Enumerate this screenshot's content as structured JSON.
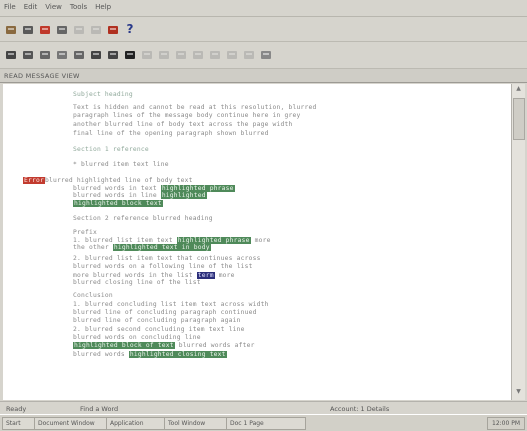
{
  "menu": [
    {
      "label": "File",
      "name": "menu-file"
    },
    {
      "label": "Edit",
      "name": "menu-edit"
    },
    {
      "label": "View",
      "name": "menu-view"
    },
    {
      "label": "Tools",
      "name": "menu-tools"
    },
    {
      "label": "Help",
      "name": "menu-help"
    }
  ],
  "toolbar1": [
    {
      "icon": "print-icon",
      "color": "#8a6a40"
    },
    {
      "icon": "cut-icon",
      "color": "#5a5a5a"
    },
    {
      "icon": "car-icon",
      "color": "#c0392b"
    },
    {
      "icon": "cart-icon",
      "color": "#666"
    },
    {
      "icon": "gear-icon",
      "color": "#999",
      "dim": true
    },
    {
      "icon": "pencil-icon",
      "color": "#999",
      "dim": true
    },
    {
      "icon": "flag-icon",
      "color": "#b03020"
    },
    {
      "icon": "help-icon",
      "color": "#2a3a8a",
      "glyph": "?"
    }
  ],
  "toolbar2": [
    {
      "icon": "pointer-icon",
      "color": "#444"
    },
    {
      "icon": "check-icon",
      "color": "#555"
    },
    {
      "icon": "grid-icon",
      "color": "#666"
    },
    {
      "icon": "list-icon",
      "color": "#777"
    },
    {
      "icon": "page-icon",
      "color": "#666"
    },
    {
      "icon": "table-icon",
      "color": "#444"
    },
    {
      "icon": "columns-icon",
      "color": "#444"
    },
    {
      "icon": "block-icon",
      "color": "#222"
    },
    {
      "icon": "arrow-icon",
      "color": "#999",
      "dim": true
    },
    {
      "icon": "brush-icon",
      "color": "#999",
      "dim": true
    },
    {
      "icon": "pen-icon",
      "color": "#999",
      "dim": true
    },
    {
      "icon": "line-icon",
      "color": "#999",
      "dim": true
    },
    {
      "icon": "frame-icon",
      "color": "#999",
      "dim": true
    },
    {
      "icon": "image-icon",
      "color": "#999",
      "dim": true
    },
    {
      "icon": "stack-icon",
      "color": "#999",
      "dim": true
    },
    {
      "icon": "doc-icon",
      "color": "#888"
    }
  ],
  "address": "READ MESSAGE VIEW",
  "doc_lines": [
    {
      "text": "Subject heading",
      "cls": "head"
    },
    {
      "text": "Text is hidden and cannot be read at this resolution, blurred"
    },
    {
      "text": "paragraph lines of the message body continue here in grey"
    },
    {
      "text": "another blurred line of body text across the page width"
    },
    {
      "text": "final line of the opening paragraph shown blurred"
    },
    {
      "text": "Section 1 reference",
      "cls": "head"
    },
    {
      "text": "* blurred item text line"
    },
    {
      "text": "blurred text line continues with",
      "segs": [
        {
          "t": "Error",
          "c": "hlred"
        },
        {
          "t": "blurred highlighted line of body text"
        }
      ]
    },
    {
      "text": "following line with highlight",
      "segs": [
        {
          "t": "blurred words in text "
        },
        {
          "t": "highlighted phrase",
          "c": "hl"
        }
      ]
    },
    {
      "text": "additional line with highlight",
      "segs": [
        {
          "t": "blurred words in line "
        },
        {
          "t": "highlighted",
          "c": "hl"
        }
      ]
    },
    {
      "text": "",
      "segs": [
        {
          "t": "highlighted block text",
          "c": "hl"
        }
      ]
    },
    {
      "text": "Section 2 reference blurred heading"
    },
    {
      "text": "Prefix"
    },
    {
      "text": "line with highlight",
      "segs": [
        {
          "t": "1. blurred list item text "
        },
        {
          "t": "highlighted phrase",
          "c": "hl"
        },
        {
          "t": " more"
        }
      ]
    },
    {
      "text": "line with highlight",
      "segs": [
        {
          "t": "the other "
        },
        {
          "t": "highlighted text in body",
          "c": "hl"
        }
      ]
    },
    {
      "text": "2. blurred list item text that continues across"
    },
    {
      "text": "blurred words on a following line of the list"
    },
    {
      "text": "line with blue",
      "segs": [
        {
          "t": "more blurred words in the list "
        },
        {
          "t": "term",
          "c": "hlblue"
        },
        {
          "t": " more"
        }
      ]
    },
    {
      "text": "blurred closing line of the list"
    },
    {
      "text": "Conclusion"
    },
    {
      "text": "1. blurred concluding list item text across width"
    },
    {
      "text": "blurred line of concluding paragraph continued"
    },
    {
      "text": "blurred line of concluding paragraph again"
    },
    {
      "text": "2. blurred second concluding item text line"
    },
    {
      "text": "blurred words on concluding line"
    },
    {
      "text": "",
      "segs": [
        {
          "t": "highlighted block of text",
          "c": "hl"
        },
        {
          "t": " blurred words after"
        }
      ]
    },
    {
      "text": "",
      "segs": [
        {
          "t": "blurred words "
        },
        {
          "t": "highlighted closing text",
          "c": "hl"
        }
      ]
    }
  ],
  "status": {
    "left": "Ready",
    "mid": "Find a Word",
    "right": "Account: 1 Details"
  },
  "taskbar": {
    "tasks": [
      "Start",
      "Document Window",
      "Application",
      "Tool Window",
      "Doc 1 Page"
    ],
    "tray": "12:00 PM"
  }
}
